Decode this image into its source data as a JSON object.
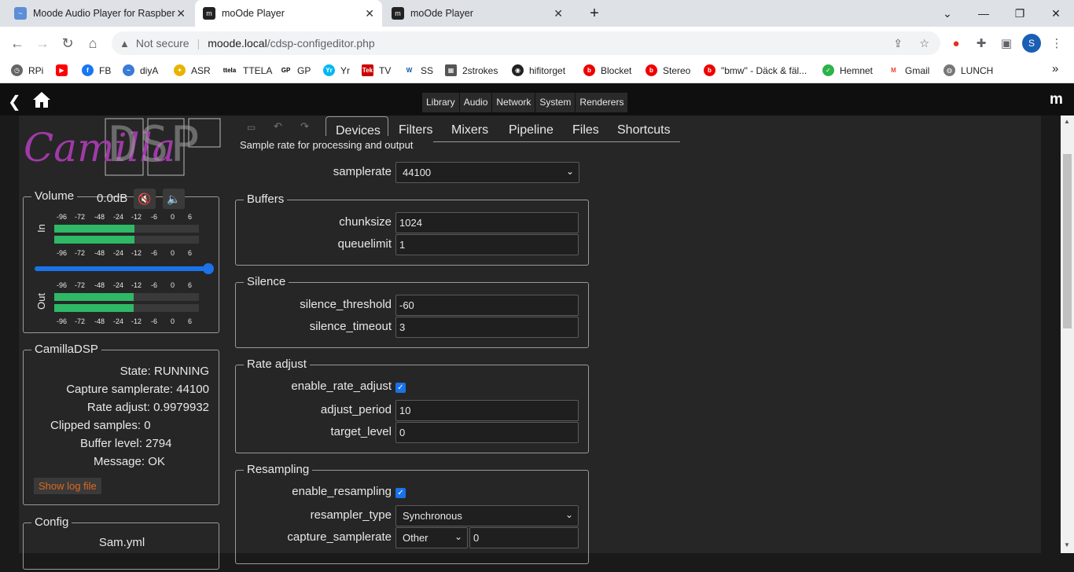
{
  "browser": {
    "tabs": [
      {
        "title": "Moode Audio Player for Raspber",
        "active": false
      },
      {
        "title": "moOde Player",
        "active": true
      },
      {
        "title": "moOde Player",
        "active": false
      }
    ],
    "new_tab": "+",
    "address": {
      "security": "Not secure",
      "host": "moode.local",
      "path": "/cdsp-configeditor.php"
    },
    "bookmarks": [
      "RPi",
      "",
      "FB",
      "diyA",
      "ASR",
      "TTELA",
      "GP",
      "Yr",
      "TV",
      "SS",
      "2strokes",
      "hifitorget",
      "Blocket",
      "Stereo",
      "\"bmw\" - Däck & fäl...",
      "Hemnet",
      "Gmail",
      "LUNCH"
    ],
    "bookmark_overflow": "»",
    "profile_initial": "S"
  },
  "nav": {
    "buttons": [
      "Library",
      "Audio",
      "Network",
      "System",
      "Renderers"
    ],
    "logo": "m"
  },
  "editor_tabs": [
    "Devices",
    "Filters",
    "Mixers",
    "Pipeline",
    "Files",
    "Shortcuts"
  ],
  "tooltip": "Sample rate for processing and output",
  "devices": {
    "samplerate_label": "samplerate",
    "samplerate_value": "44100",
    "buffers": {
      "legend": "Buffers",
      "chunksize_label": "chunksize",
      "chunksize_value": "1024",
      "queuelimit_label": "queuelimit",
      "queuelimit_value": "1"
    },
    "silence": {
      "legend": "Silence",
      "threshold_label": "silence_threshold",
      "threshold_value": "-60",
      "timeout_label": "silence_timeout",
      "timeout_value": "3"
    },
    "rate_adjust": {
      "legend": "Rate adjust",
      "enable_label": "enable_rate_adjust",
      "enable_checked": true,
      "period_label": "adjust_period",
      "period_value": "10",
      "target_label": "target_level",
      "target_value": "0"
    },
    "resampling": {
      "legend": "Resampling",
      "enable_label": "enable_resampling",
      "enable_checked": true,
      "type_label": "resampler_type",
      "type_value": "Synchronous",
      "capture_label": "capture_samplerate",
      "capture_select": "Other",
      "capture_value": "0"
    }
  },
  "volume": {
    "legend": "Volume",
    "value": "0.0dB",
    "in_label": "In",
    "out_label": "Out",
    "scale": [
      "-96",
      "-72",
      "-48",
      "-24",
      "-12",
      "-6",
      "0",
      "6"
    ],
    "in_level": 0.75,
    "out_level": 0.67,
    "slider": 1.0,
    "meter_color": "#2fb865"
  },
  "camilladsp": {
    "legend": "CamillaDSP",
    "rows": [
      {
        "label": "State:",
        "value": "RUNNING"
      },
      {
        "label": "Capture samplerate:",
        "value": "44100"
      },
      {
        "label": "Rate adjust:",
        "value": "0.9979932"
      },
      {
        "label": "Clipped samples:",
        "value": "0"
      },
      {
        "label": "Buffer level:",
        "value": "2794"
      },
      {
        "label": "Message:",
        "value": "OK"
      }
    ],
    "log_button": "Show log file"
  },
  "config": {
    "legend": "Config",
    "file": "Sam.yml"
  },
  "logo_text": "Camilla",
  "logo_dsp": "DSP"
}
